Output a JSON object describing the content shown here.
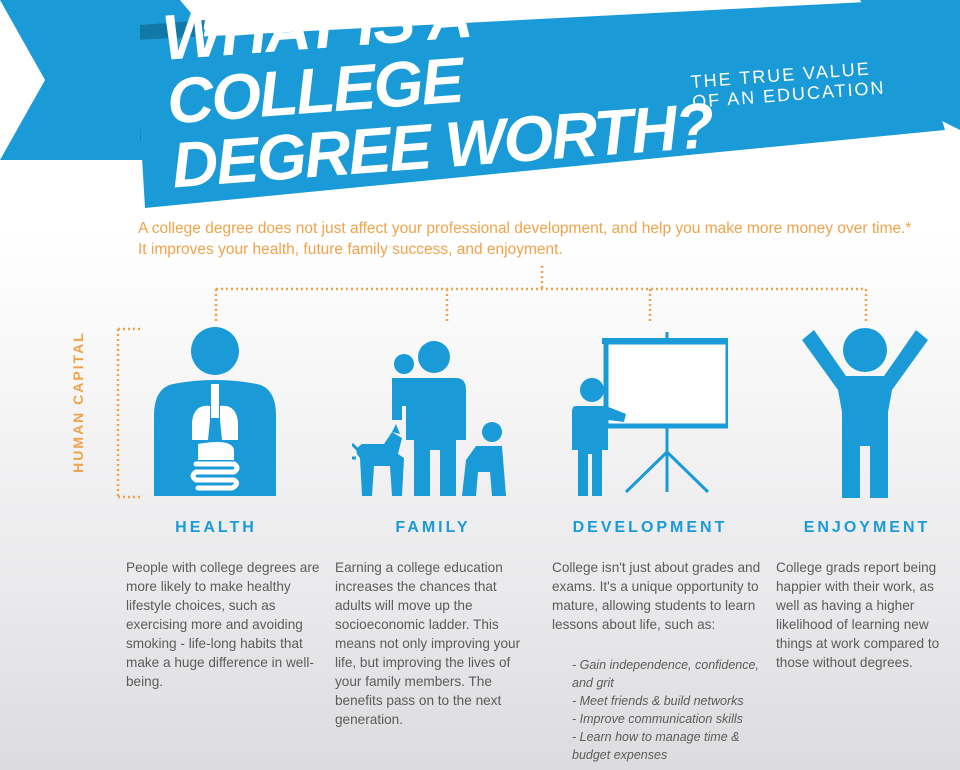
{
  "header": {
    "title_line1": "WHAT IS A COLLEGE",
    "title_line2": "DEGREE WORTH?",
    "subtitle_line1": "THE TRUE VALUE",
    "subtitle_line2": "OF AN EDUCATION"
  },
  "intro": {
    "line1": "A college degree does not just affect your professional development, and help you make more money over time.*",
    "line2": "It improves your health, future family success, and enjoyment."
  },
  "side_label": "HUMAN CAPITAL",
  "colors": {
    "blue": "#1a9bd7",
    "orange": "#f0a34a",
    "text": "#5b5b5b"
  },
  "columns": [
    {
      "title": "HEALTH",
      "icon": "health-body-icon",
      "text": "People with college degrees are more likely to make healthy lifestyle choices, such as exercising more and avoiding smoking - life-long habits that make a huge difference in well-being."
    },
    {
      "title": "FAMILY",
      "icon": "family-icon",
      "text": "Earning a college education increases the chances that adults will move up the socioeconomic ladder. This means not only improving your life, but improving the lives of your family members. The benefits pass on to the next generation."
    },
    {
      "title": "DEVELOPMENT",
      "icon": "presentation-icon",
      "text": "College isn't just about grades and exams. It's a unique opportunity to mature, allowing students to learn lessons about life, such as:",
      "bullets": [
        "- Gain independence, confidence, and grit",
        "- Meet friends & build networks",
        "- Improve communication skills",
        "- Learn how to manage time & budget expenses"
      ]
    },
    {
      "title": "ENJOYMENT",
      "icon": "raised-arms-person-icon",
      "text": "College grads report being happier with their work, as well as having a higher likelihood of learning new things at work compared to those without degrees."
    }
  ]
}
